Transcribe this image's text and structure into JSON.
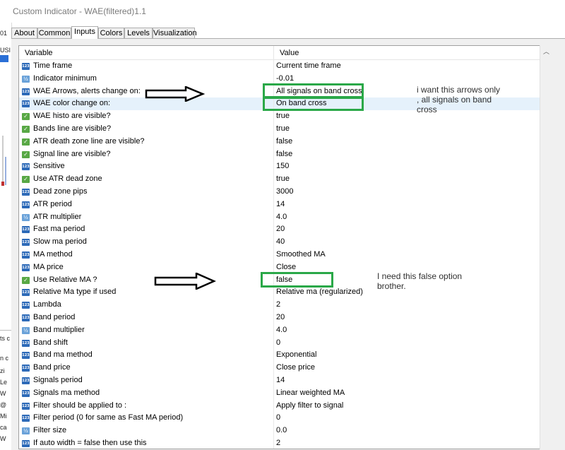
{
  "window": {
    "title": "Custom Indicator - WAE(filtered)1.1"
  },
  "tabs": [
    "About",
    "Common",
    "Inputs",
    "Colors",
    "Levels",
    "Visualization"
  ],
  "active_tab": "Inputs",
  "grid": {
    "headers": {
      "variable": "Variable",
      "value": "Value"
    },
    "rows": [
      {
        "icon": "num",
        "variable": "Time frame",
        "value": "Current time frame"
      },
      {
        "icon": "dbl",
        "variable": "Indicator minimum",
        "value": "-0.01"
      },
      {
        "icon": "num",
        "variable": "WAE Arrows, alerts change on:",
        "value": "All signals on band cross"
      },
      {
        "icon": "num",
        "variable": "WAE color change on:",
        "value": "On band cross"
      },
      {
        "icon": "bool",
        "variable": "WAE histo are visible?",
        "value": "true"
      },
      {
        "icon": "bool",
        "variable": "Bands line are visible?",
        "value": "true"
      },
      {
        "icon": "bool",
        "variable": "ATR death zone line are visible?",
        "value": "false"
      },
      {
        "icon": "bool",
        "variable": "Signal line are visible?",
        "value": "false"
      },
      {
        "icon": "num",
        "variable": "Sensitive",
        "value": "150"
      },
      {
        "icon": "bool",
        "variable": "Use ATR dead zone",
        "value": "true"
      },
      {
        "icon": "num",
        "variable": "Dead zone pips",
        "value": "3000"
      },
      {
        "icon": "num",
        "variable": "ATR period",
        "value": "14"
      },
      {
        "icon": "dbl",
        "variable": "ATR multiplier",
        "value": "4.0"
      },
      {
        "icon": "num",
        "variable": "Fast ma period",
        "value": "20"
      },
      {
        "icon": "num",
        "variable": "Slow ma period",
        "value": "40"
      },
      {
        "icon": "num",
        "variable": "MA method",
        "value": "Smoothed MA"
      },
      {
        "icon": "num",
        "variable": "MA price",
        "value": "Close"
      },
      {
        "icon": "bool",
        "variable": "Use Relative MA ?",
        "value": "false"
      },
      {
        "icon": "num",
        "variable": "Relative Ma type if used",
        "value": "Relative ma (regularized)"
      },
      {
        "icon": "num",
        "variable": "Lambda",
        "value": "2"
      },
      {
        "icon": "num",
        "variable": "Band period",
        "value": "20"
      },
      {
        "icon": "dbl",
        "variable": "Band multiplier",
        "value": "4.0"
      },
      {
        "icon": "num",
        "variable": "Band shift",
        "value": "0"
      },
      {
        "icon": "num",
        "variable": "Band ma method",
        "value": "Exponential"
      },
      {
        "icon": "num",
        "variable": "Band price",
        "value": "Close price"
      },
      {
        "icon": "num",
        "variable": "Signals period",
        "value": "14"
      },
      {
        "icon": "num",
        "variable": "Signals ma method",
        "value": "Linear weighted MA"
      },
      {
        "icon": "num",
        "variable": "Filter should be applied to :",
        "value": "Apply filter to signal"
      },
      {
        "icon": "num",
        "variable": "Filter period (0 for same as Fast MA period)",
        "value": "0"
      },
      {
        "icon": "dbl",
        "variable": "Filter size",
        "value": "0.0"
      },
      {
        "icon": "num",
        "variable": "If auto width = false then use this",
        "value": "2"
      }
    ]
  },
  "selected_row": 3,
  "annotations": {
    "note1": [
      "i want this arrows only",
      ", all signals on band",
      "cross"
    ],
    "note2": [
      "I need this false option",
      "brother."
    ]
  },
  "left_strip": {
    "texts": [
      "01",
      "USI",
      "ts c",
      "n c",
      "zi",
      "Le",
      "W",
      "@",
      "Mi",
      "ca",
      "W"
    ]
  },
  "colors": {
    "highlight_box": "#2aa848",
    "arrow": "#000000",
    "selected_row": "#e5f1fb"
  }
}
